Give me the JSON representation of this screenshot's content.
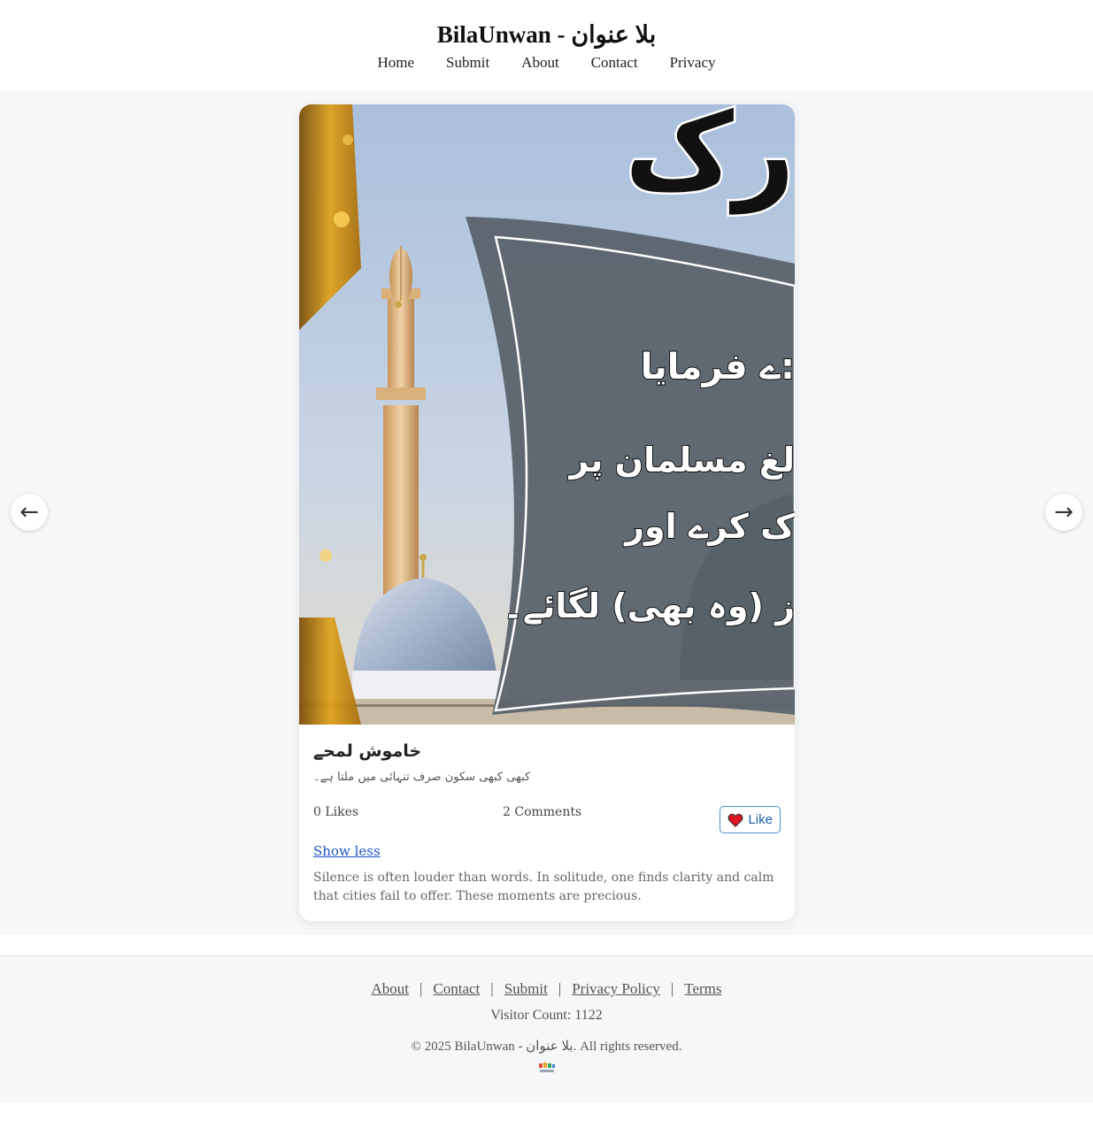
{
  "site": {
    "title": "BilaUnwan - بلا عنوان"
  },
  "nav": {
    "items": [
      {
        "label": "Home"
      },
      {
        "label": "Submit"
      },
      {
        "label": "About"
      },
      {
        "label": "Contact"
      },
      {
        "label": "Privacy"
      }
    ]
  },
  "carousel": {
    "prev_icon": "←",
    "next_icon": "→"
  },
  "post": {
    "image_text": {
      "top": "رک",
      "line1": "ے فرمایا:",
      "line2": "لغ مسلمان پر",
      "line3": "ک کرے اور",
      "line4": "ز (وہ بھی) لگائے۔"
    },
    "title": "خاموش لمحے",
    "excerpt": "کبھی کبھی سکون صرف تنہائی میں ملتا ہے۔",
    "likes": "0 Likes",
    "comments": "2 Comments",
    "like_label": "Like",
    "toggle_label": "Show less",
    "full_text": "Silence is often louder than words. In solitude, one finds clarity and calm that cities fail to offer. These moments are precious."
  },
  "footer": {
    "links": [
      {
        "label": "About"
      },
      {
        "label": "Contact"
      },
      {
        "label": "Submit"
      },
      {
        "label": "Privacy Policy"
      },
      {
        "label": "Terms"
      }
    ],
    "separator": "|",
    "visitor": "Visitor Count: 1122",
    "copyright": "© 2025 BilaUnwan - بلا عنوان. All rights reserved."
  },
  "colors": {
    "accent": "#1a56c6",
    "like_border": "#4a8fd8",
    "heart": "#e0141e",
    "page_bg": "#f6f7f9"
  }
}
